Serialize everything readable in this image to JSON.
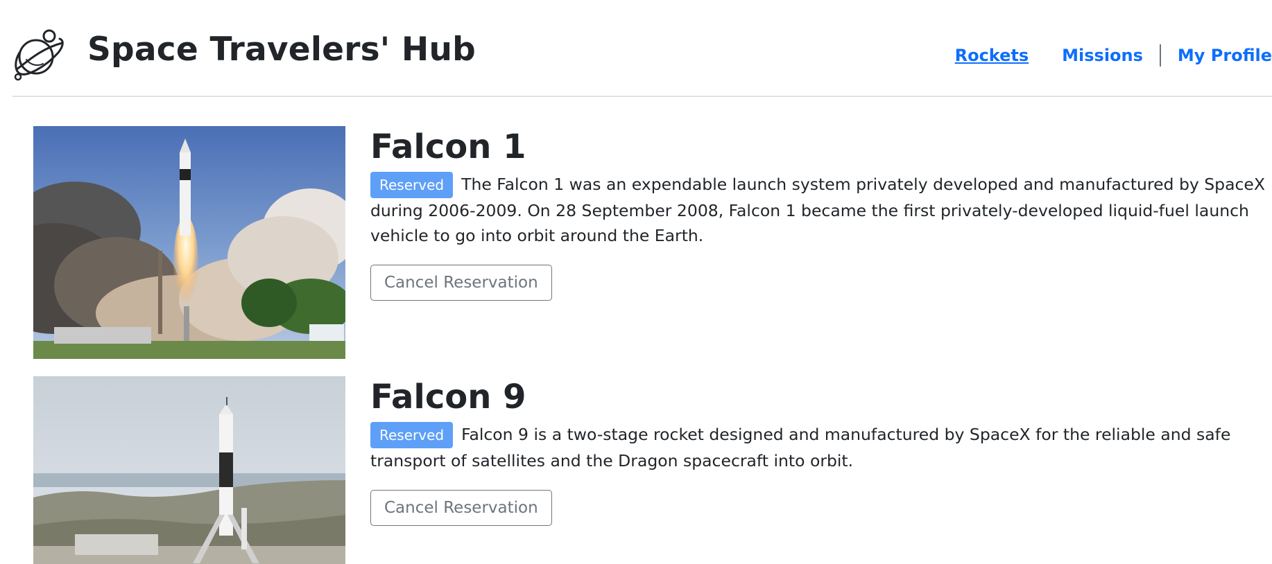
{
  "header": {
    "brand": "Space Travelers' Hub",
    "logo_icon": "planet-icon",
    "nav": {
      "rockets": "Rockets",
      "missions": "Missions",
      "profile": "My Profile"
    }
  },
  "rockets": [
    {
      "name": "Falcon 1",
      "badge": "Reserved",
      "description": "The Falcon 1 was an expendable launch system privately developed and manufactured by SpaceX during 2006-2009. On 28 September 2008, Falcon 1 became the first privately-developed liquid-fuel launch vehicle to go into orbit around the Earth.",
      "button": "Cancel Reservation"
    },
    {
      "name": "Falcon 9",
      "badge": "Reserved",
      "description": "Falcon 9 is a two-stage rocket designed and manufactured by SpaceX for the reliable and safe transport of satellites and the Dragon spacecraft into orbit.",
      "button": "Cancel Reservation"
    }
  ],
  "colors": {
    "link": "#0d6efd",
    "badge": "#5e9ff8",
    "button_border": "#6c757d"
  }
}
